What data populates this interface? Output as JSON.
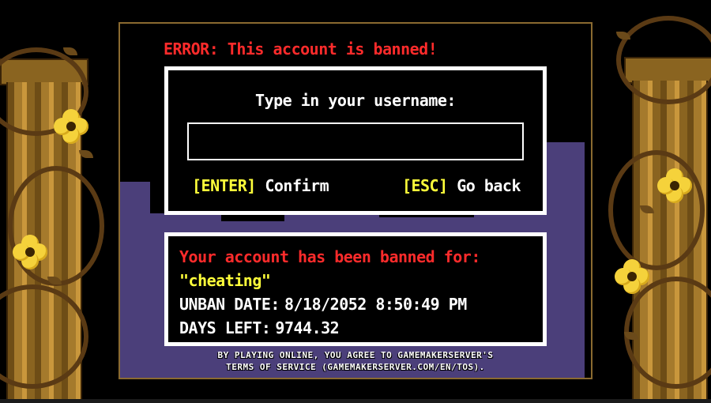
{
  "error_title": "ERROR: This account is banned!",
  "prompt": {
    "label": "Type in your username:",
    "username_value": "",
    "confirm_key": "[ENTER]",
    "confirm_label": "Confirm",
    "back_key": "[ESC]",
    "back_label": "Go back"
  },
  "ban": {
    "reason_heading": "Your account has been banned for:",
    "reason": "\"cheating\"",
    "unban_label": "UNBAN DATE:",
    "unban_date": "8/18/2052 8:50:49 PM",
    "days_left_label": "DAYS LEFT:",
    "days_left": "9744.32"
  },
  "tos": {
    "line1": "BY PLAYING ONLINE, YOU AGREE TO GAMEMAKERSERVER'S",
    "line2": "TERMS OF SERVICE (GAMEMAKERSERVER.COM/EN/TOS)."
  },
  "colors": {
    "error_red": "#ff2b2b",
    "key_yellow": "#ffff3a",
    "text_white": "#ffffff",
    "castle_purple": "#4b3f7a",
    "pillar_gold": "#a57a2c",
    "flower_yellow": "#f5d23b"
  }
}
